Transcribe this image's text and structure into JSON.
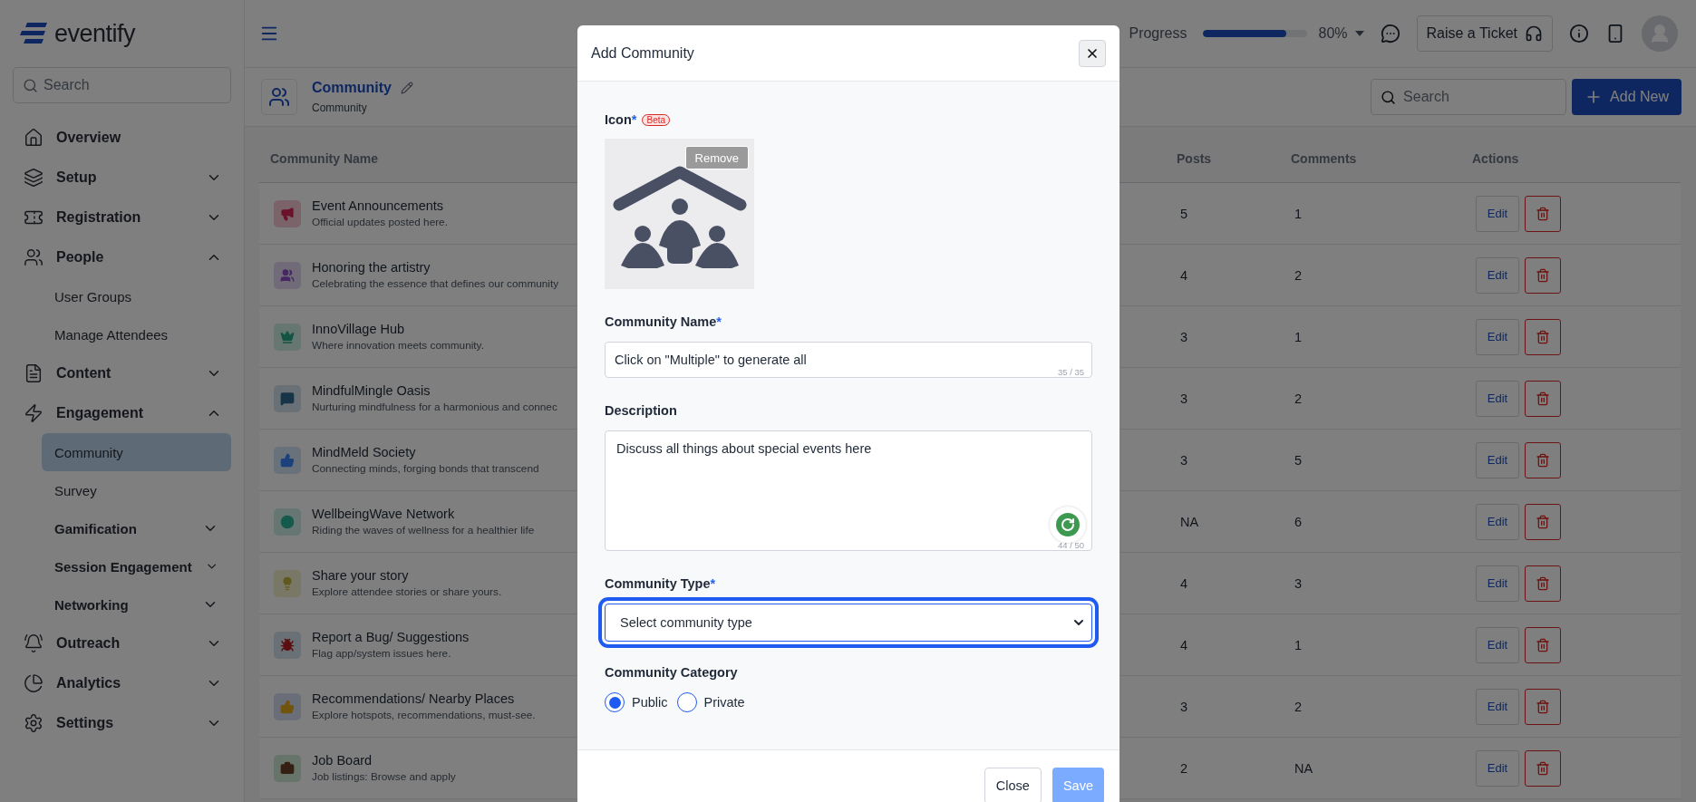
{
  "sidebar": {
    "logo": "eventify",
    "search": {
      "placeholder": "Search"
    },
    "nav": [
      {
        "kind": "link",
        "label": "Overview",
        "selected": false
      },
      {
        "kind": "group",
        "label": "Setup",
        "expanded": false,
        "selected": false
      },
      {
        "kind": "group",
        "label": "Registration",
        "expanded": false,
        "selected": false
      },
      {
        "kind": "group",
        "label": "People",
        "expanded": true,
        "selected": false,
        "children": [
          {
            "kind": "link",
            "label": "User Groups",
            "selected": false
          },
          {
            "kind": "link",
            "label": "Manage Attendees",
            "selected": false
          }
        ]
      },
      {
        "kind": "group",
        "label": "Content",
        "expanded": false,
        "selected": false
      },
      {
        "kind": "group",
        "label": "Engagement",
        "expanded": true,
        "selected": false,
        "children": [
          {
            "kind": "link",
            "label": "Community",
            "selected": true
          },
          {
            "kind": "link",
            "label": "Survey",
            "selected": false
          },
          {
            "kind": "group",
            "label": "Gamification",
            "expanded": false,
            "selected": false
          },
          {
            "kind": "group",
            "label": "Session Engagement",
            "expanded": false,
            "selected": false
          },
          {
            "kind": "group",
            "label": "Networking",
            "expanded": false,
            "selected": false
          }
        ]
      },
      {
        "kind": "group",
        "label": "Outreach",
        "expanded": false,
        "selected": false
      },
      {
        "kind": "group",
        "label": "Analytics",
        "expanded": false,
        "selected": false
      },
      {
        "kind": "group",
        "label": "Settings",
        "expanded": false,
        "selected": false
      }
    ]
  },
  "topbar": {
    "progress": {
      "label": "Progress",
      "level": 0.8,
      "reading": "80%"
    },
    "ticket_button": "Raise a Ticket"
  },
  "page_header": {
    "title": "Community",
    "subtitle": "Community",
    "search": {
      "placeholder": "Search"
    },
    "add_button": "Add New"
  },
  "table": {
    "columns": [
      "Community Name",
      "Posts",
      "Comments",
      "Actions"
    ],
    "rows": [
      {
        "name": "Event Announcements",
        "description": "Official updates posted here.",
        "posts": "5",
        "comments": "1",
        "edit": "Edit"
      },
      {
        "name": "Honoring the artistry",
        "description": "Celebrating the essence that defines our community",
        "posts": "4",
        "comments": "2",
        "edit": "Edit"
      },
      {
        "name": "InnoVillage Hub",
        "description": "Where innovation meets community.",
        "posts": "3",
        "comments": "1",
        "edit": "Edit"
      },
      {
        "name": "MindfulMingle Oasis",
        "description": "Nurturing mindfulness for a harmonious and connec",
        "posts": "3",
        "comments": "2",
        "edit": "Edit"
      },
      {
        "name": "MindMeld Society",
        "description": "Connecting minds, forging bonds that transcend",
        "posts": "3",
        "comments": "5",
        "edit": "Edit"
      },
      {
        "name": "WellbeingWave Network",
        "description": "Riding the waves of wellness for a healthier life",
        "posts": "NA",
        "comments": "6",
        "edit": "Edit"
      },
      {
        "name": "Share your story",
        "description": "Explore attendee stories or share yours.",
        "posts": "4",
        "comments": "3",
        "edit": "Edit"
      },
      {
        "name": "Report a Bug/ Suggestions",
        "description": "Flag app/system issues here.",
        "posts": "4",
        "comments": "1",
        "edit": "Edit"
      },
      {
        "name": "Recommendations/ Nearby Places",
        "description": "Explore hotspots, recommendations, must-see.",
        "posts": "3",
        "comments": "2",
        "edit": "Edit"
      },
      {
        "name": "Job Board",
        "description": "Job listings: Browse and apply",
        "posts": "2",
        "comments": "NA",
        "edit": "Edit"
      }
    ]
  },
  "modal": {
    "title": "Add Community",
    "icon_field": {
      "label": "Icon",
      "required_mark": "*",
      "badge": "Beta",
      "remove_button": "Remove"
    },
    "name_field": {
      "label": "Community Name",
      "required_mark": "*",
      "value": "Click on \"Multiple\" to generate all",
      "counter": "35 / 35"
    },
    "description_field": {
      "label": "Description",
      "value": "Discuss all things about special events here",
      "counter": "44 / 50"
    },
    "type_field": {
      "label": "Community Type",
      "required_mark": "*",
      "placeholder": "Select community type",
      "focused": true
    },
    "category_field": {
      "label": "Community Category",
      "options": [
        {
          "label": "Public",
          "selected": true
        },
        {
          "label": "Private",
          "selected": false
        }
      ]
    },
    "buttons": [
      {
        "kind": "secondary",
        "label": "Close",
        "disabled": false
      },
      {
        "kind": "primary",
        "label": "Save",
        "disabled": true
      }
    ]
  }
}
